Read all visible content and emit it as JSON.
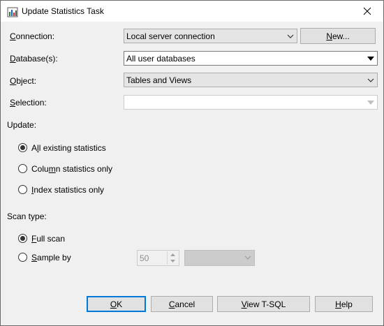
{
  "window": {
    "title": "Update Statistics Task",
    "icon": "task-icon",
    "close_icon": "close-icon"
  },
  "connection": {
    "label": "Connection:",
    "value": "Local server connection",
    "new_button": "New..."
  },
  "databases": {
    "label": "Database(s):",
    "value": "All user databases"
  },
  "object": {
    "label": "Object:",
    "value": "Tables and Views"
  },
  "selection": {
    "label": "Selection:",
    "value": ""
  },
  "update": {
    "label": "Update:",
    "options": [
      {
        "label": "All existing statistics",
        "selected": true
      },
      {
        "label": "Column statistics only",
        "selected": false
      },
      {
        "label": "Index statistics only",
        "selected": false
      }
    ]
  },
  "scan_type": {
    "label": "Scan type:",
    "options": [
      {
        "label": "Full scan",
        "selected": true
      },
      {
        "label": "Sample by",
        "selected": false
      }
    ],
    "sample_value": "50",
    "sample_unit": ""
  },
  "footer": {
    "ok": "OK",
    "cancel": "Cancel",
    "view_tsql": "View T-SQL",
    "help": "Help"
  },
  "colors": {
    "accent": "#0078d7",
    "window_bg": "#f0f0f0",
    "disabled_text": "#8d8d8d"
  }
}
